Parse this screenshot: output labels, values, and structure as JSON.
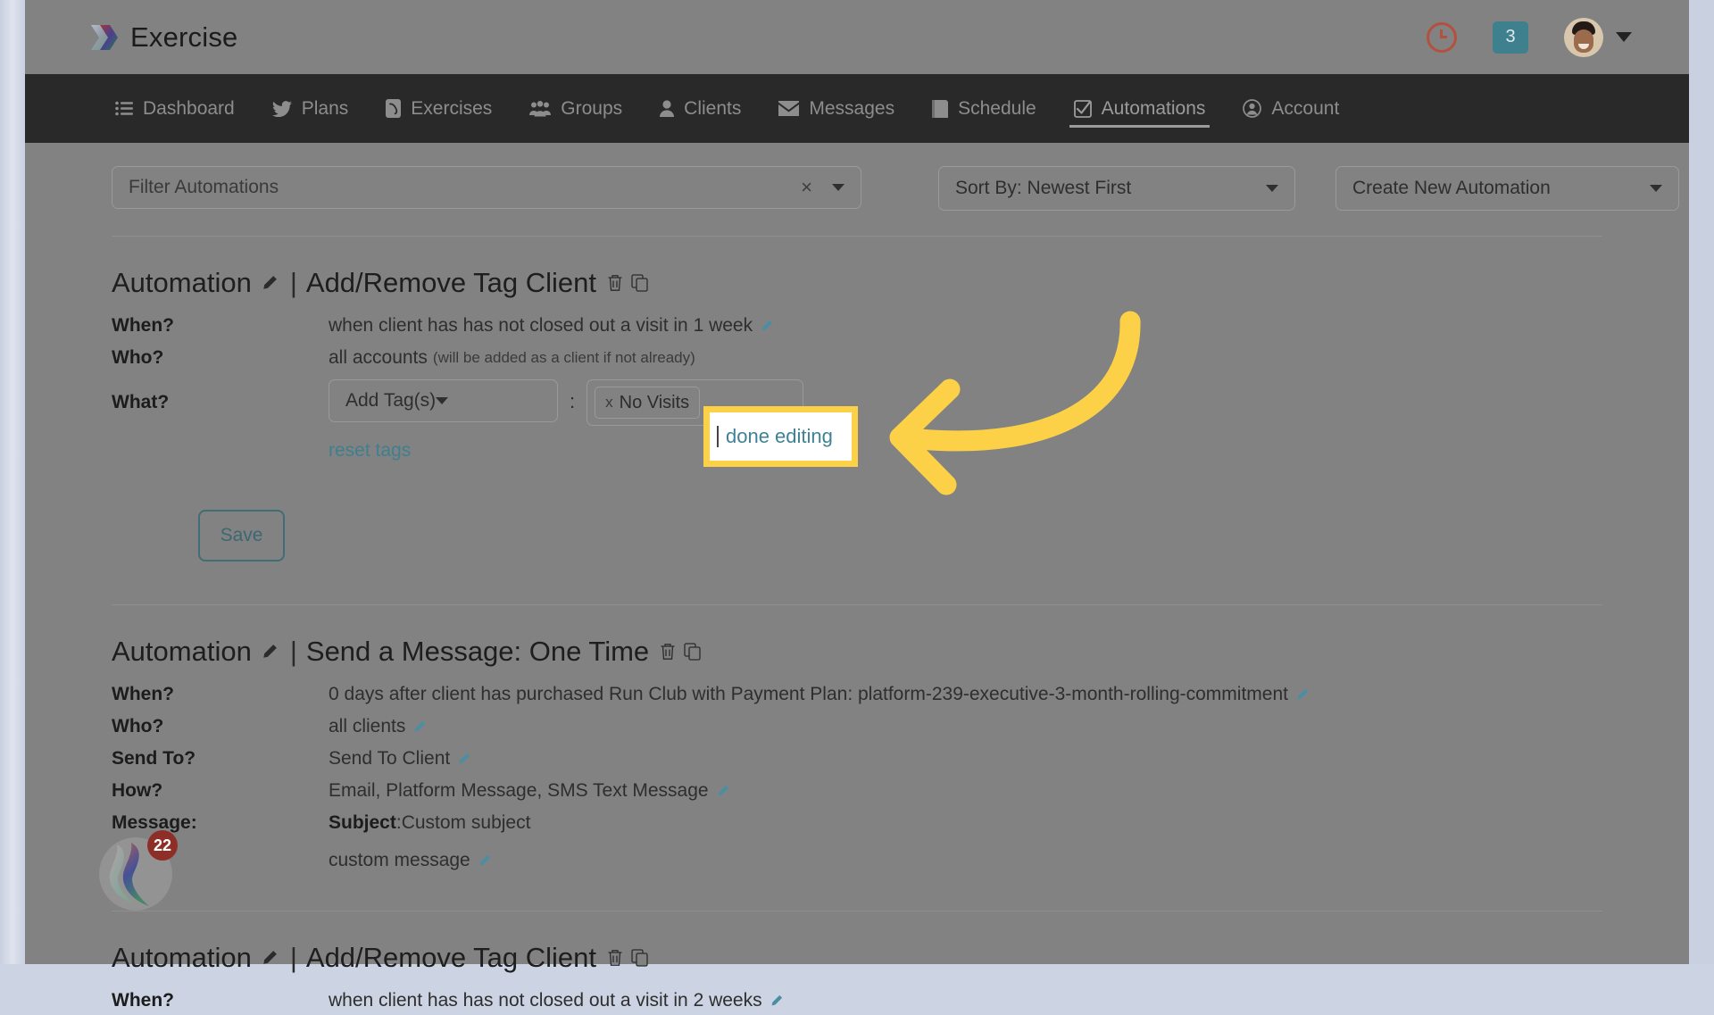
{
  "app": {
    "brand": "Exercise",
    "logo_icon": "exercise-logo-icon"
  },
  "header": {
    "history_icon": "clock-icon",
    "notifications_count": "3",
    "avatar_icon": "user-avatar",
    "chevron_icon": "chevron-down-icon"
  },
  "nav": {
    "items": [
      {
        "label": "Dashboard",
        "icon": "list-icon",
        "active": false
      },
      {
        "label": "Plans",
        "icon": "bird-icon",
        "active": false
      },
      {
        "label": "Exercises",
        "icon": "phone-icon",
        "active": false
      },
      {
        "label": "Groups",
        "icon": "users-icon",
        "active": false
      },
      {
        "label": "Clients",
        "icon": "user-icon",
        "active": false
      },
      {
        "label": "Messages",
        "icon": "envelope-icon",
        "active": false
      },
      {
        "label": "Schedule",
        "icon": "book-icon",
        "active": false
      },
      {
        "label": "Automations",
        "icon": "check-square-icon",
        "active": true
      },
      {
        "label": "Account",
        "icon": "user-circle-icon",
        "active": false
      }
    ]
  },
  "toolbar": {
    "filter_placeholder": "Filter Automations",
    "filter_value": "",
    "clear_icon": "close-icon",
    "sort_label": "Sort By: Newest First",
    "create_label": "Create New Automation",
    "caret_icon": "caret-down-icon"
  },
  "automations": [
    {
      "title_prefix": "Automation",
      "separator": "|",
      "title": "Add/Remove Tag Client",
      "edit_icon": "pencil-icon",
      "delete_icon": "trash-icon",
      "copy_icon": "copy-icon",
      "rows": [
        {
          "label": "When?",
          "value": "when client has has not closed out a visit in 1 week",
          "editable": true
        },
        {
          "label": "Who?",
          "value": "all accounts",
          "note": "(will be added as a client if not already)",
          "editable": false
        }
      ],
      "what": {
        "label": "What?",
        "action_select": "Add Tag(s)",
        "colon": ":",
        "tags": [
          {
            "remove_icon": "x",
            "label": "No Visits"
          }
        ]
      },
      "links": {
        "reset": "reset tags",
        "divider": "|",
        "done": "done editing"
      },
      "save_label": "Save"
    },
    {
      "title_prefix": "Automation",
      "separator": "|",
      "title": "Send a Message: One Time",
      "edit_icon": "pencil-icon",
      "delete_icon": "trash-icon",
      "copy_icon": "copy-icon",
      "rows": [
        {
          "label": "When?",
          "value": "0 days after client has purchased Run Club with Payment Plan: platform-239-executive-3-month-rolling-commitment",
          "editable": true
        },
        {
          "label": "Who?",
          "value": "all clients",
          "editable": true
        },
        {
          "label": "Send To?",
          "value": "Send To Client",
          "editable": true
        },
        {
          "label": "How?",
          "value": "Email, Platform Message, SMS Text Message",
          "editable": true
        }
      ],
      "message": {
        "label": "Message:",
        "subject_label": "Subject",
        "subject_sep": ": ",
        "subject_value": "Custom subject",
        "body_value": "custom message"
      }
    },
    {
      "title_prefix": "Automation",
      "separator": "|",
      "title": "Add/Remove Tag Client",
      "edit_icon": "pencil-icon",
      "delete_icon": "trash-icon",
      "copy_icon": "copy-icon",
      "rows": [
        {
          "label": "When?",
          "value": "when client has has not closed out a visit in 2 weeks",
          "editable": true
        }
      ]
    }
  ],
  "callout": {
    "highlight_text": "done editing",
    "cursor": "|",
    "arrow_icon": "curved-arrow-left-icon",
    "highlight_color": "#fcd147"
  },
  "chat_widget": {
    "badge_count": "22",
    "icon": "chat-launcher-icon"
  },
  "colors": {
    "nav_bg": "#292929",
    "page_dim": "#828282",
    "accent_teal": "#3f7f8e",
    "accent_red": "#b4503e",
    "highlight_yellow": "#fcd147"
  }
}
